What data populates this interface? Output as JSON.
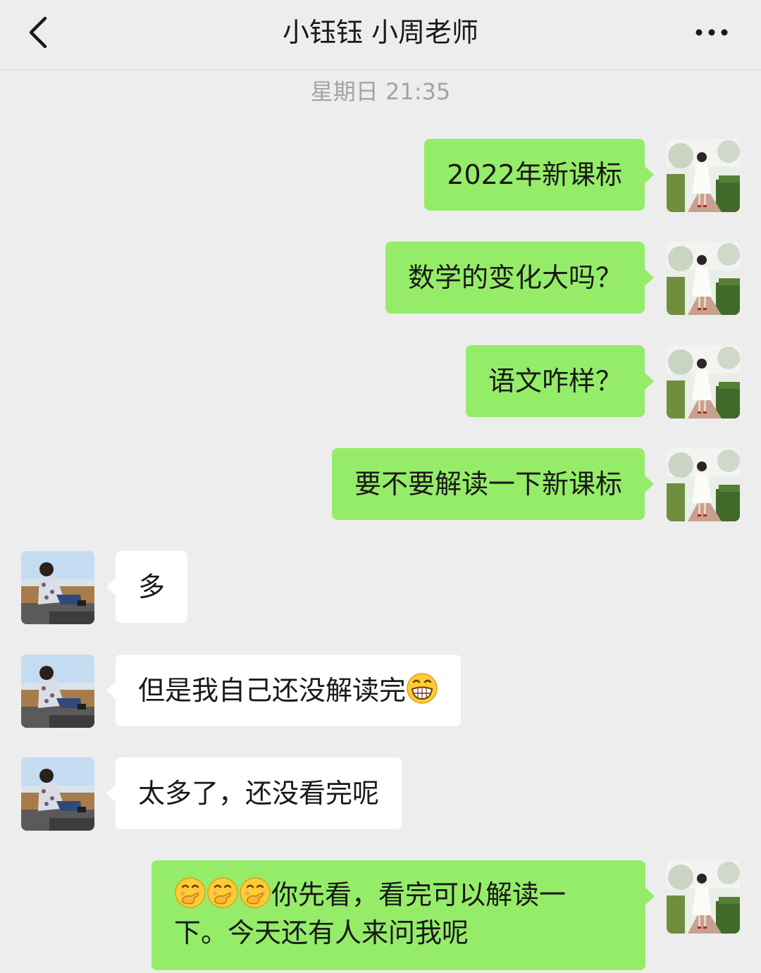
{
  "header": {
    "title": "小钰钰 小周老师",
    "back_icon": "chevron-left-icon",
    "more_icon": "more-dots-icon"
  },
  "chat": {
    "timestamp": "星期日 21:35",
    "messages": [
      {
        "sender": "me",
        "text": "2022年新课标"
      },
      {
        "sender": "me",
        "text": "数学的变化大吗？"
      },
      {
        "sender": "me",
        "text": "语文咋样？"
      },
      {
        "sender": "me",
        "text": "要不要解读一下新课标"
      },
      {
        "sender": "other",
        "text": "多"
      },
      {
        "sender": "other",
        "text": "但是我自己还没解读完",
        "emoji": "grin-emoji"
      },
      {
        "sender": "other",
        "text": "太多了，还没看完呢"
      },
      {
        "sender": "me",
        "emoji": "thinking-face-emoji",
        "emoji_count": 3,
        "line1": "你先看，看完可以解读一",
        "line2": "下。今天还有人来问我呢"
      }
    ]
  },
  "colors": {
    "background": "#ededed",
    "my_bubble": "#95ec69",
    "other_bubble": "#ffffff",
    "timestamp": "#a3a3a3"
  }
}
